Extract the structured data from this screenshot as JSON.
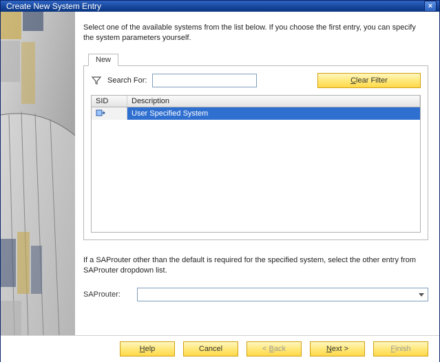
{
  "window": {
    "title": "Create New System Entry",
    "close_label": "×"
  },
  "instructions": "Select one of the available systems from the list below. If you choose the first entry, you can specify the system parameters yourself.",
  "tab": {
    "label": "New"
  },
  "search": {
    "label": "Search For:",
    "value": "",
    "clear_label": "Clear Filter",
    "clear_mnemonic": "C"
  },
  "grid": {
    "columns": {
      "sid": "SID",
      "desc": "Description"
    },
    "rows": [
      {
        "sid": "",
        "desc": "User Specified System",
        "selected": true
      }
    ]
  },
  "help_text": "If a SAProuter other than the default is required for the specified system, select the other entry from SAProuter dropdown list.",
  "router": {
    "label": "SAProuter:",
    "value": ""
  },
  "buttons": {
    "help": "Help",
    "help_m": "H",
    "cancel": "Cancel",
    "cancel_m": "C",
    "back": "< Back",
    "back_m": "B",
    "next": "Next >",
    "next_m": "N",
    "finish": "Finish",
    "finish_m": "F"
  }
}
